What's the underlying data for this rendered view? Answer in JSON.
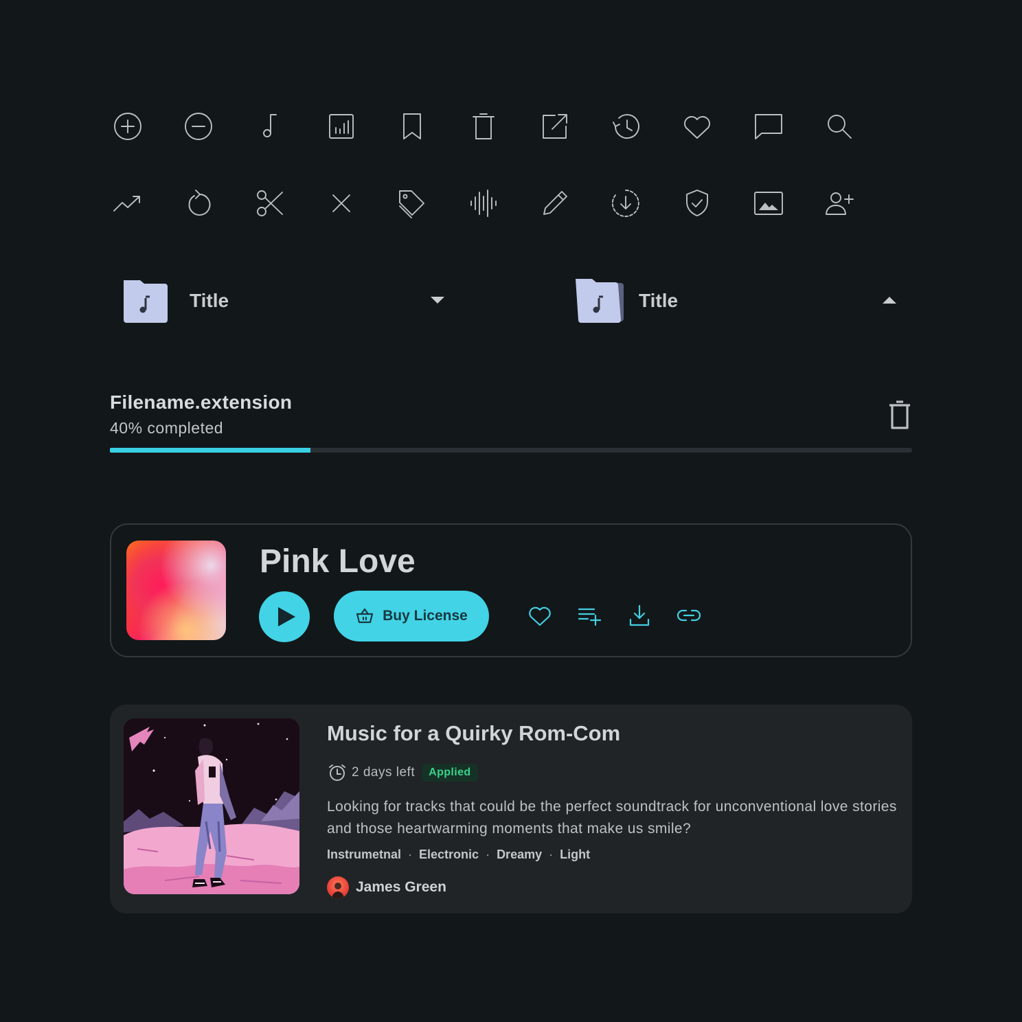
{
  "icons": {
    "row1": [
      "add-circle-icon",
      "remove-circle-icon",
      "music-note-icon",
      "chart-box-icon",
      "bookmark-icon",
      "trash-icon",
      "open-external-icon",
      "history-icon",
      "heart-icon",
      "comment-icon",
      "search-icon"
    ],
    "row2": [
      "trending-up-icon",
      "refresh-icon",
      "scissors-icon",
      "close-icon",
      "tags-icon",
      "waveform-icon",
      "pencil-icon",
      "download-circle-icon",
      "shield-check-icon",
      "image-icon",
      "add-user-icon"
    ],
    "color": "#bcc0c5"
  },
  "folders": [
    {
      "title": "Title",
      "state": "collapsed",
      "caret": "caret-down-icon"
    },
    {
      "title": "Title",
      "state": "expanded",
      "caret": "caret-up-icon"
    }
  ],
  "upload": {
    "filename": "Filename.extension",
    "status": "40% completed",
    "progress": 0.25,
    "accent": "#3ad0e3"
  },
  "track": {
    "title": "Pink Love",
    "buy_label": "Buy License",
    "accent": "#42d3e6",
    "actions": [
      "heart-icon",
      "add-to-playlist-icon",
      "download-icon",
      "link-icon"
    ]
  },
  "brief": {
    "title": "Music for a Quirky Rom-Com",
    "deadline": "2 days left",
    "badge": "Applied",
    "description": "Looking for tracks that could be the perfect soundtrack for unconventional love stories and those heartwarming moments that make us smile?",
    "tags": [
      "Instrumetnal",
      "Electronic",
      "Dreamy",
      "Light"
    ],
    "author": "James Green",
    "badge_color": "#39d48c"
  }
}
